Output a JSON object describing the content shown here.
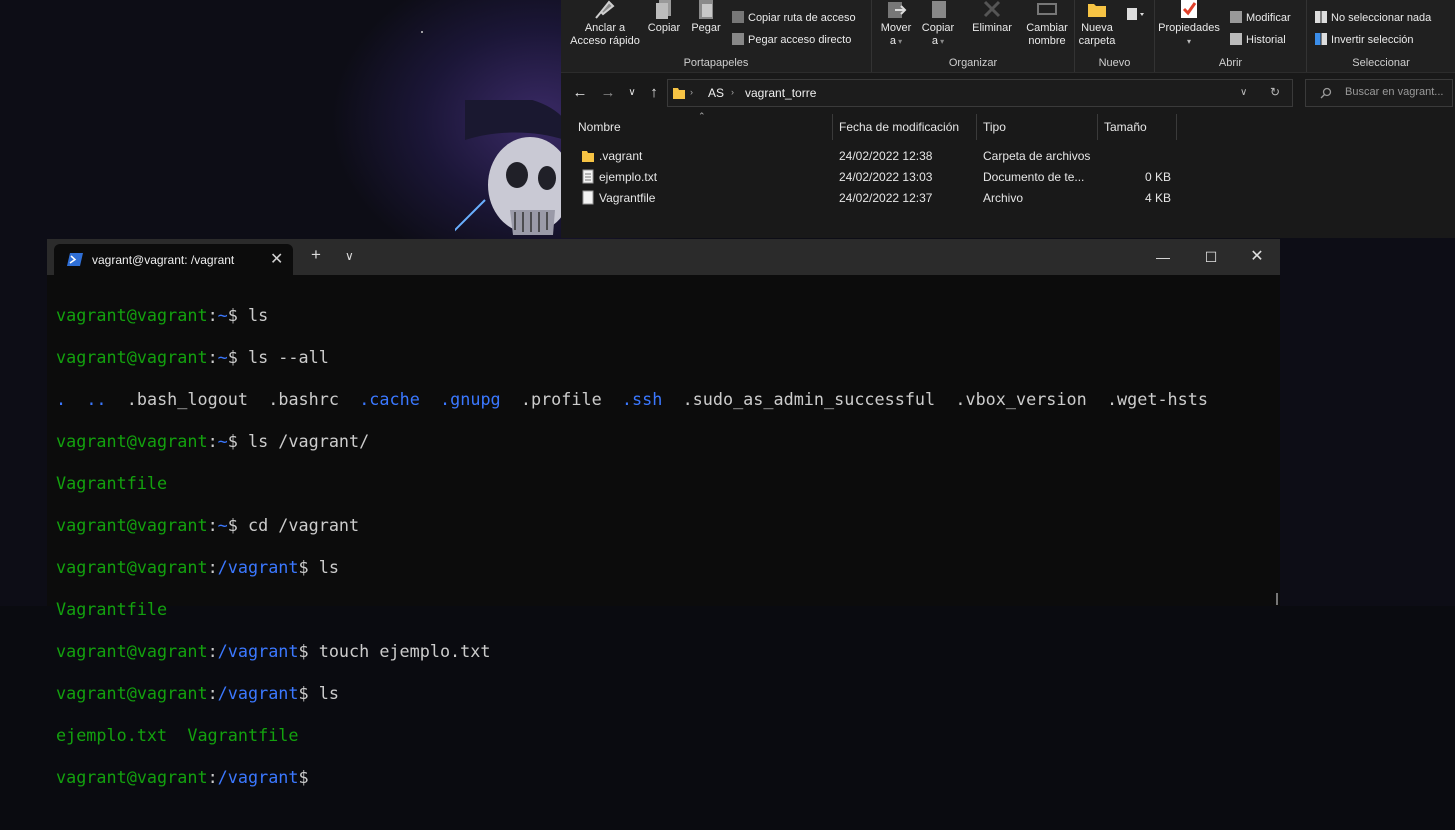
{
  "explorer": {
    "ribbon": {
      "clipboard": {
        "pin_label_1": "Anclar a",
        "pin_label_2": "Acceso rápido",
        "copy_label": "Copiar",
        "paste_label": "Pegar",
        "copy_path_label": "Copiar ruta de acceso",
        "paste_shortcut_label": "Pegar acceso directo",
        "group_title": "Portapapeles"
      },
      "organize": {
        "move_label_1": "Mover",
        "move_label_2": "a",
        "copyto_label_1": "Copiar",
        "copyto_label_2": "a",
        "delete_label": "Eliminar",
        "rename_label_1": "Cambiar",
        "rename_label_2": "nombre",
        "group_title": "Organizar"
      },
      "new": {
        "newfolder_label_1": "Nueva",
        "newfolder_label_2": "carpeta",
        "group_title": "Nuevo"
      },
      "open": {
        "properties_label": "Propiedades",
        "modify_label": "Modificar",
        "history_label": "Historial",
        "group_title": "Abrir"
      },
      "select": {
        "select_none_label": "No seleccionar nada",
        "invert_label": "Invertir selección",
        "group_title": "Seleccionar"
      }
    },
    "address": {
      "crumbs": [
        "AS",
        "vagrant_torre"
      ],
      "search_placeholder": "Buscar en vagrant..."
    },
    "columns": {
      "name": "Nombre",
      "modified": "Fecha de modificación",
      "type": "Tipo",
      "size": "Tamaño"
    },
    "files": [
      {
        "name": ".vagrant",
        "modified": "24/02/2022 12:38",
        "type": "Carpeta de archivos",
        "size": "",
        "icon": "folder-icon"
      },
      {
        "name": "ejemplo.txt",
        "modified": "24/02/2022 13:03",
        "type": "Documento de te...",
        "size": "0 KB",
        "icon": "text-file-icon"
      },
      {
        "name": "Vagrantfile",
        "modified": "24/02/2022 12:37",
        "type": "Archivo",
        "size": "4 KB",
        "icon": "file-icon"
      }
    ]
  },
  "terminal": {
    "tab_title": "vagrant@vagrant: /vagrant",
    "prompt_user": "vagrant@vagrant",
    "lines": {
      "l1_cmd": " ls",
      "l2_cmd": " ls --all",
      "l3": {
        "dot": ".",
        "dotdot": "..",
        "bash_logout": ".bash_logout",
        "bashrc": ".bashrc",
        "cache": ".cache",
        "gnupg": ".gnupg",
        "profile": ".profile",
        "ssh": ".ssh",
        "sudo": ".sudo_as_admin_successful",
        "vbox": ".vbox_version",
        "wget": ".wget-hsts"
      },
      "l4_cmd": " ls /vagrant/",
      "l5_out": "Vagrantfile",
      "l6_cmd": " cd /vagrant",
      "l7_cmd": " ls",
      "l8_out": "Vagrantfile",
      "l9_cmd": " touch ejemplo.txt",
      "l10_cmd": " ls",
      "l11_out": "ejemplo.txt  Vagrantfile"
    },
    "path_home": "~",
    "path_vagrant": "/vagrant",
    "colors": {
      "prompt": "#13a10e",
      "path": "#3b78ff",
      "text": "#cccccc",
      "background": "#0c0c0c"
    }
  }
}
